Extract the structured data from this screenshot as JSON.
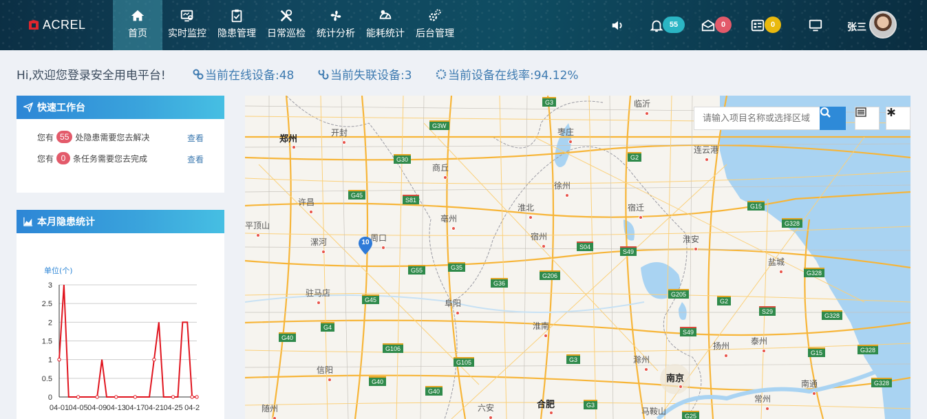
{
  "brand": {
    "name": "ACREL"
  },
  "nav": {
    "items": [
      {
        "label": "首页",
        "icon": "home-icon"
      },
      {
        "label": "实时监控",
        "icon": "monitor-icon"
      },
      {
        "label": "隐患管理",
        "icon": "clipboard-icon"
      },
      {
        "label": "日常巡检",
        "icon": "tools-icon"
      },
      {
        "label": "统计分析",
        "icon": "fan-icon"
      },
      {
        "label": "能耗统计",
        "icon": "energy-icon"
      },
      {
        "label": "后台管理",
        "icon": "gears-icon"
      }
    ],
    "active": "首页"
  },
  "header": {
    "bell_count": "55",
    "mail_count": "0",
    "task_count": "0",
    "user_name": "张三"
  },
  "welcome": {
    "greeting": "Hi,欢迎您登录安全用电平台!",
    "online": "当前在线设备:48",
    "offline": "当前失联设备:3",
    "rate": "当前设备在线率:94.12%"
  },
  "quick": {
    "title": "快速工作台",
    "row1": {
      "prefix": "您有",
      "count": "55",
      "suffix": "处隐患需要您去解决",
      "link": "查看"
    },
    "row2": {
      "prefix": "您有",
      "count": "0",
      "suffix": "条任务需要您去完成",
      "link": "查看"
    }
  },
  "hazard": {
    "title": "本月隐患统计"
  },
  "chart_data": {
    "type": "line",
    "ylabel": "单位(个)",
    "ylim": [
      0,
      3
    ],
    "yticks": [
      "0",
      "0.5",
      "1",
      "1.5",
      "2",
      "2.5",
      "3"
    ],
    "xticklabels": [
      "04-01",
      "04-05",
      "04-09",
      "04-13",
      "04-17",
      "04-21",
      "04-25",
      "04-2"
    ],
    "x": [
      1,
      2,
      3,
      4,
      5,
      6,
      7,
      8,
      9,
      10,
      11,
      12,
      13,
      14,
      15,
      16,
      17,
      18,
      19,
      20,
      21,
      22,
      23,
      24,
      25,
      26,
      27,
      28,
      29,
      30
    ],
    "series": [
      {
        "values": [
          1,
          3,
          0,
          0,
          0,
          0,
          0,
          0,
          0,
          1,
          0,
          0,
          0,
          0,
          0,
          0,
          0,
          0,
          0,
          0,
          1,
          2,
          0,
          0,
          0,
          0,
          2,
          2,
          0,
          0
        ],
        "color": "#e0141e"
      }
    ]
  },
  "map": {
    "search_placeholder": "请输入项目名称或选择区域",
    "pin_count": "10",
    "cities": [
      {
        "name": "郑州",
        "big": true
      },
      {
        "name": "开封"
      },
      {
        "name": "许昌"
      },
      {
        "name": "平顶山"
      },
      {
        "name": "漯河"
      },
      {
        "name": "周口"
      },
      {
        "name": "驻马店"
      },
      {
        "name": "信阳"
      },
      {
        "name": "随州"
      },
      {
        "name": "商丘"
      },
      {
        "name": "亳州"
      },
      {
        "name": "阜阳"
      },
      {
        "name": "淮北"
      },
      {
        "name": "宿州"
      },
      {
        "name": "淮南"
      },
      {
        "name": "六安"
      },
      {
        "name": "合肥",
        "big": true
      },
      {
        "name": "枣庄"
      },
      {
        "name": "临沂"
      },
      {
        "name": "徐州"
      },
      {
        "name": "宿迁"
      },
      {
        "name": "淮安"
      },
      {
        "name": "盐城"
      },
      {
        "name": "连云港"
      },
      {
        "name": "滁州"
      },
      {
        "name": "南京",
        "big": true
      },
      {
        "name": "扬州"
      },
      {
        "name": "泰州"
      },
      {
        "name": "马鞍山"
      },
      {
        "name": "常州"
      },
      {
        "name": "南通"
      }
    ],
    "roads": [
      "G3",
      "G3W",
      "G30",
      "G2",
      "G45",
      "S81",
      "G15",
      "G328",
      "G35",
      "G55",
      "S04",
      "S49",
      "G206",
      "G36",
      "G205",
      "G2",
      "S29",
      "G328",
      "G328",
      "G45",
      "G4",
      "G40",
      "G106",
      "G105",
      "G3",
      "S49",
      "G15",
      "G328",
      "G328",
      "G40",
      "G40",
      "G3",
      "G25"
    ]
  },
  "colors": {
    "accent": "#2e8ad8",
    "danger": "#e35a6a",
    "line": "#e0141e"
  }
}
